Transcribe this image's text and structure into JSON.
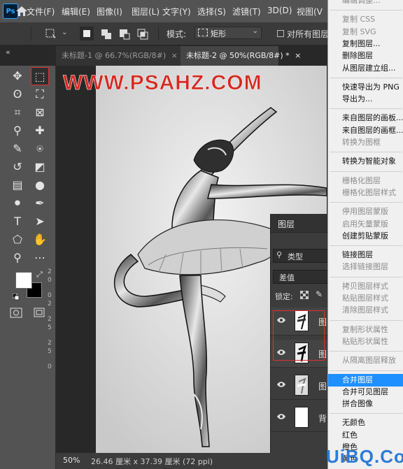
{
  "app": {
    "logo_text": "Ps",
    "logo_color": "#31a8ff"
  },
  "menu": [
    {
      "key": "file",
      "label": "文件(F)"
    },
    {
      "key": "edit",
      "label": "编辑(E)"
    },
    {
      "key": "image",
      "label": "图像(I)"
    },
    {
      "key": "layer",
      "label": "图层(L)"
    },
    {
      "key": "type",
      "label": "文字(Y)"
    },
    {
      "key": "select",
      "label": "选择(S)"
    },
    {
      "key": "filter",
      "label": "滤镜(T)"
    },
    {
      "key": "3d",
      "label": "3D(D)"
    },
    {
      "key": "view",
      "label": "视图(V"
    }
  ],
  "options_bar": {
    "mode_label": "模式:",
    "mode_value": "矩形",
    "all_layers_label": "对所有图层"
  },
  "tabs": [
    {
      "label": "未标题-1 @ 66.7%(RGB/8#)",
      "close": "×",
      "active": false
    },
    {
      "label": "未标题-2 @ 50%(RGB/8#) *",
      "close": "×",
      "active": true
    }
  ],
  "tabs_collapse": "«",
  "ruler_digits": [
    "2",
    "0",
    "0",
    "2",
    "2",
    "5",
    "2",
    "5",
    "0"
  ],
  "watermark": "WWW.PSAHZ.COM",
  "status": {
    "zoom": "50%",
    "doc_info": "26.46 厘米 x 37.39 厘米 (72 ppi)"
  },
  "layers_panel": {
    "title": "图层",
    "filter_label": "类型",
    "blend_mode": "差值",
    "lock_label": "锁定:",
    "layers": [
      {
        "name": "图",
        "thumb": "dancer-inverted"
      },
      {
        "name": "图",
        "thumb": "dancer-dark"
      },
      {
        "name": "图",
        "thumb": "dancer-photo"
      },
      {
        "name": "背",
        "thumb": "white"
      }
    ]
  },
  "context_menu": {
    "items": [
      {
        "label": "编辑调整...",
        "disabled": true
      },
      {
        "sep": true
      },
      {
        "label": "复制 CSS",
        "disabled": true
      },
      {
        "label": "复制 SVG",
        "disabled": true
      },
      {
        "label": "复制图层...",
        "disabled": false
      },
      {
        "label": "删除图层",
        "disabled": false
      },
      {
        "label": "从图层建立组...",
        "disabled": false
      },
      {
        "sep": true
      },
      {
        "label": "快速导出为 PNG",
        "disabled": false
      },
      {
        "label": "导出为...",
        "disabled": false
      },
      {
        "sep": true
      },
      {
        "label": "来自图层的画板...",
        "disabled": false
      },
      {
        "label": "来自图层的画框...",
        "disabled": false
      },
      {
        "label": "转换为图框",
        "disabled": true
      },
      {
        "sep": true
      },
      {
        "label": "转换为智能对象",
        "disabled": false
      },
      {
        "sep": true
      },
      {
        "label": "栅格化图层",
        "disabled": true
      },
      {
        "label": "栅格化图层样式",
        "disabled": true
      },
      {
        "sep": true
      },
      {
        "label": "停用图层蒙版",
        "disabled": true
      },
      {
        "label": "启用矢量蒙版",
        "disabled": true
      },
      {
        "label": "创建剪贴蒙版",
        "disabled": false
      },
      {
        "sep": true
      },
      {
        "label": "链接图层",
        "disabled": false
      },
      {
        "label": "选择链接图层",
        "disabled": true
      },
      {
        "sep": true
      },
      {
        "label": "拷贝图层样式",
        "disabled": true
      },
      {
        "label": "粘贴图层样式",
        "disabled": true
      },
      {
        "label": "清除图层样式",
        "disabled": true
      },
      {
        "sep": true
      },
      {
        "label": "复制形状属性",
        "disabled": true
      },
      {
        "label": "粘贴形状属性",
        "disabled": true
      },
      {
        "sep": true
      },
      {
        "label": "从隔离图层释放",
        "disabled": true
      },
      {
        "sep": true
      },
      {
        "label": "合并图层",
        "disabled": false,
        "highlighted": true
      },
      {
        "label": "合并可见图层",
        "disabled": false
      },
      {
        "label": "拼合图像",
        "disabled": false
      },
      {
        "sep": true
      },
      {
        "label": "无颜色",
        "disabled": false
      },
      {
        "label": "红色",
        "disabled": false
      },
      {
        "label": "橙色",
        "disabled": false
      },
      {
        "label": "黄色",
        "disabled": false
      }
    ]
  },
  "corner_logo": "UiBQ.CoM",
  "colors": {
    "highlight": "#1e90ff",
    "watermark": "#d42a22",
    "selection_box": "#e03030"
  }
}
